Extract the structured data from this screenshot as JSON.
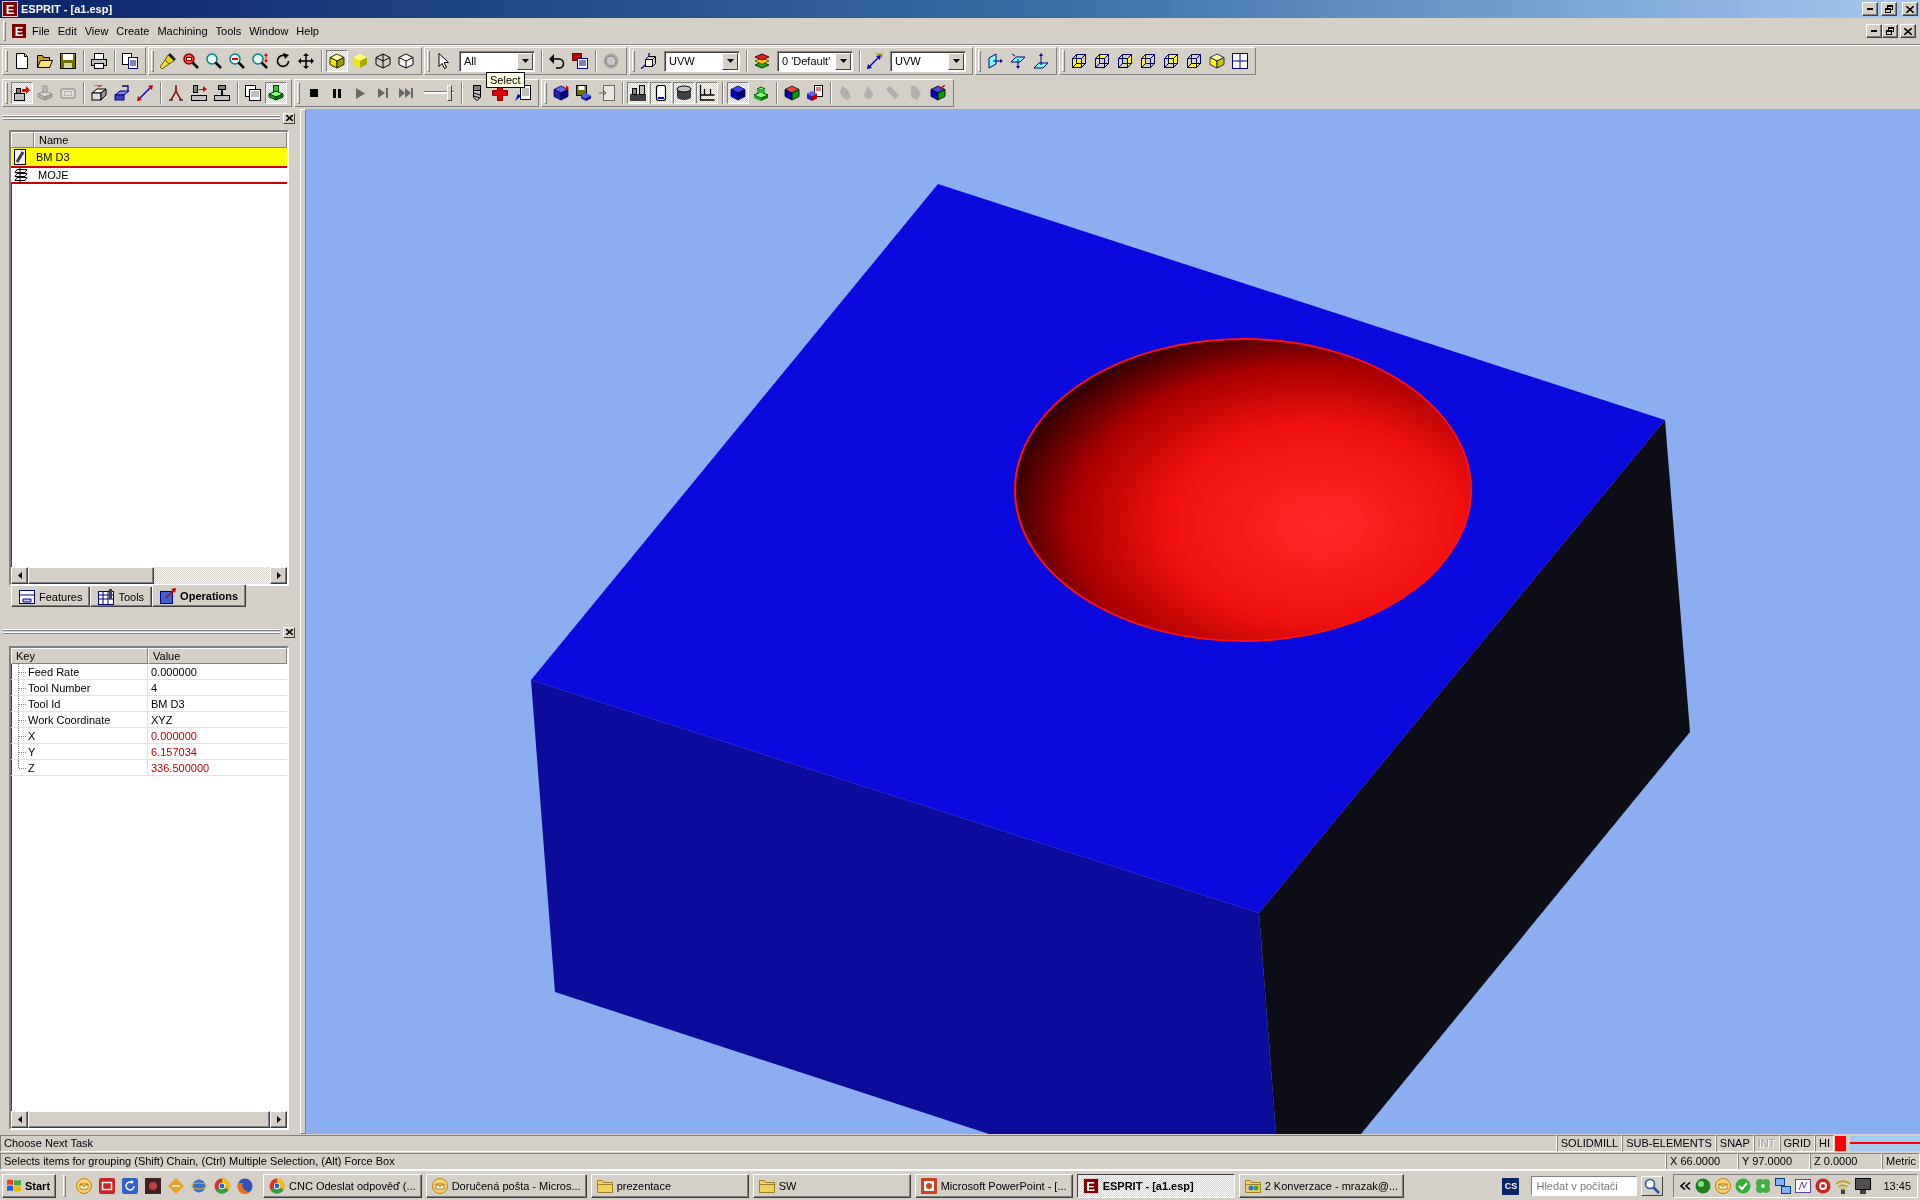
{
  "window": {
    "logo": "E",
    "title": "ESPRIT - [a1.esp]"
  },
  "menu_bar": {
    "logo": "E",
    "items": [
      "File",
      "Edit",
      "View",
      "Create",
      "Machining",
      "Tools",
      "Window",
      "Help"
    ]
  },
  "toolbar_rows": [
    {
      "toolbars": [
        {
          "groups": [
            [
              {
                "kind": "button",
                "pressed": false,
                "disabled": false
              },
              {
                "kind": "button",
                "pressed": false,
                "disabled": false
              },
              {
                "kind": "button",
                "pressed": false,
                "disabled": false
              }
            ],
            [
              {
                "kind": "button",
                "pressed": false,
                "disabled": false
              }
            ],
            [
              {
                "kind": "button",
                "pressed": false,
                "disabled": false
              }
            ]
          ]
        },
        {
          "groups": [
            [
              {
                "kind": "button",
                "pressed": false,
                "disabled": false
              },
              {
                "kind": "button",
                "pressed": false,
                "disabled": false
              },
              {
                "kind": "button",
                "pressed": false,
                "disabled": false
              },
              {
                "kind": "button",
                "pressed": false,
                "disabled": false
              },
              {
                "kind": "button",
                "pressed": false,
                "disabled": false
              },
              {
                "kind": "button",
                "pressed": false,
                "disabled": false
              },
              {
                "kind": "button",
                "pressed": false,
                "disabled": false
              }
            ],
            [
              {
                "kind": "button",
                "pressed": true,
                "disabled": false
              },
              {
                "kind": "button",
                "pressed": false,
                "disabled": false
              },
              {
                "kind": "button",
                "pressed": false,
                "disabled": false
              },
              {
                "kind": "button",
                "pressed": false,
                "disabled": false
              }
            ]
          ]
        },
        {
          "groups": [
            [
              {
                "kind": "button",
                "pressed": false,
                "disabled": false
              },
              {
                "kind": "dropdown",
                "value": "All"
              }
            ],
            [
              {
                "kind": "button",
                "pressed": false,
                "disabled": false
              },
              {
                "kind": "button",
                "pressed": false,
                "disabled": false
              }
            ],
            [
              {
                "kind": "button",
                "pressed": false,
                "disabled": false
              }
            ]
          ]
        },
        {
          "groups": [
            [
              {
                "kind": "button",
                "pressed": false,
                "disabled": false
              },
              {
                "kind": "dropdown",
                "value": "UVW"
              }
            ],
            [
              {
                "kind": "button",
                "pressed": false,
                "disabled": false
              },
              {
                "kind": "dropdown",
                "value": "0 'Default'"
              }
            ],
            [
              {
                "kind": "button",
                "pressed": false,
                "disabled": false
              },
              {
                "kind": "dropdown",
                "value": "UVW"
              }
            ]
          ]
        },
        {
          "groups": [
            [
              {
                "kind": "button",
                "pressed": false,
                "disabled": false
              },
              {
                "kind": "button",
                "pressed": false,
                "disabled": false
              },
              {
                "kind": "button",
                "pressed": false,
                "disabled": false
              }
            ]
          ]
        },
        {
          "groups": [
            [
              {
                "kind": "button",
                "pressed": false,
                "disabled": false
              },
              {
                "kind": "button",
                "pressed": false,
                "disabled": false
              },
              {
                "kind": "button",
                "pressed": false,
                "disabled": false
              },
              {
                "kind": "button",
                "pressed": false,
                "disabled": false
              },
              {
                "kind": "button",
                "pressed": false,
                "disabled": false
              },
              {
                "kind": "button",
                "pressed": false,
                "disabled": false
              },
              {
                "kind": "button",
                "pressed": false,
                "disabled": false
              },
              {
                "kind": "button",
                "pressed": false,
                "disabled": false
              }
            ]
          ]
        }
      ]
    },
    {
      "toolbars": [
        {
          "groups": [
            [
              {
                "kind": "button",
                "pressed": true,
                "disabled": false
              },
              {
                "kind": "button",
                "pressed": false,
                "disabled": true
              },
              {
                "kind": "button",
                "pressed": false,
                "disabled": true
              }
            ],
            [
              {
                "kind": "button",
                "pressed": false,
                "disabled": false
              },
              {
                "kind": "button",
                "pressed": false,
                "disabled": false
              },
              {
                "kind": "button",
                "pressed": false,
                "disabled": false
              }
            ],
            [
              {
                "kind": "button",
                "pressed": false,
                "disabled": false
              },
              {
                "kind": "button",
                "pressed": false,
                "disabled": false
              },
              {
                "kind": "button",
                "pressed": false,
                "disabled": false
              }
            ],
            [
              {
                "kind": "button",
                "pressed": false,
                "disabled": false
              },
              {
                "kind": "button",
                "pressed": true,
                "disabled": false
              }
            ]
          ]
        },
        {
          "groups": [
            [
              {
                "kind": "button",
                "pressed": false,
                "disabled": false
              },
              {
                "kind": "button",
                "pressed": false,
                "disabled": false
              },
              {
                "kind": "button",
                "pressed": false,
                "disabled": true
              },
              {
                "kind": "button",
                "pressed": false,
                "disabled": true
              },
              {
                "kind": "button",
                "pressed": false,
                "disabled": true
              },
              {
                "kind": "slider",
                "level": 0.9
              }
            ],
            [
              {
                "kind": "button",
                "pressed": false,
                "disabled": false
              },
              {
                "kind": "button",
                "pressed": false,
                "disabled": false
              },
              {
                "kind": "button",
                "pressed": false,
                "disabled": false
              }
            ]
          ]
        },
        {
          "groups": [
            [
              {
                "kind": "button",
                "pressed": false,
                "disabled": false
              },
              {
                "kind": "button",
                "pressed": false,
                "disabled": false
              },
              {
                "kind": "button",
                "pressed": false,
                "disabled": true
              }
            ],
            [
              {
                "kind": "button",
                "pressed": true,
                "disabled": false
              },
              {
                "kind": "button",
                "pressed": true,
                "disabled": false
              },
              {
                "kind": "button",
                "pressed": true,
                "disabled": false
              },
              {
                "kind": "button",
                "pressed": true,
                "disabled": false
              }
            ],
            [
              {
                "kind": "button",
                "pressed": true,
                "disabled": false
              },
              {
                "kind": "button",
                "pressed": false,
                "disabled": false
              }
            ],
            [
              {
                "kind": "button",
                "pressed": false,
                "disabled": false
              },
              {
                "kind": "button",
                "pressed": false,
                "disabled": false
              }
            ],
            [
              {
                "kind": "button",
                "pressed": false,
                "disabled": true
              },
              {
                "kind": "button",
                "pressed": false,
                "disabled": true
              },
              {
                "kind": "button",
                "pressed": false,
                "disabled": true
              },
              {
                "kind": "button",
                "pressed": false,
                "disabled": true
              },
              {
                "kind": "button",
                "pressed": false,
                "disabled": false
              }
            ]
          ]
        }
      ]
    }
  ],
  "tooltip": {
    "text": "Select"
  },
  "operations_panel": {
    "column": "Name",
    "rows": [
      {
        "kind": "tool",
        "name": "BM D3",
        "selected": true,
        "outlined": false
      },
      {
        "kind": "operation",
        "name": "MOJE",
        "selected": false,
        "outlined": true
      }
    ],
    "tabs": [
      {
        "label": "Features",
        "selected": false
      },
      {
        "label": "Tools",
        "selected": false
      },
      {
        "label": "Operations",
        "selected": true
      }
    ]
  },
  "properties_panel": {
    "columns": [
      "Key",
      "Value"
    ],
    "rows": [
      {
        "key": "Feed Rate",
        "value": "0.000000",
        "highlighted": false
      },
      {
        "key": "Tool Number",
        "value": "4",
        "highlighted": false
      },
      {
        "key": "Tool Id",
        "value": "BM D3",
        "highlighted": false
      },
      {
        "key": "Work Coordinate",
        "value": "XYZ",
        "highlighted": false
      },
      {
        "key": "X",
        "value": "0.000000",
        "highlighted": true
      },
      {
        "key": "Y",
        "value": "6.157034",
        "highlighted": true
      },
      {
        "key": "Z",
        "value": "336.500000",
        "highlighted": true
      }
    ]
  },
  "status_bar": {
    "prompt": "Choose Next Task",
    "hint": "Selects items for grouping (Shift) Chain, (Ctrl) Multiple Selection, (Alt) Force Box",
    "modes": [
      {
        "label": "SOLIDMILL",
        "enabled": true
      },
      {
        "label": "SUB-ELEMENTS",
        "enabled": true
      },
      {
        "label": "SNAP",
        "enabled": true
      },
      {
        "label": "INT",
        "enabled": false
      },
      {
        "label": "GRID",
        "enabled": true
      },
      {
        "label": "HI",
        "enabled": true
      }
    ],
    "coordinates": [
      "X 66.0000",
      "Y 97.0000",
      "Z 0.0000"
    ],
    "units": "Metric"
  },
  "taskbar": {
    "start": "Start",
    "tasks": [
      {
        "kind": "browser",
        "label": "CNC Odeslat odpověď (...",
        "selected": false
      },
      {
        "kind": "mail",
        "label": "Doručená pošta - Micros...",
        "selected": false
      },
      {
        "kind": "folder",
        "label": "prezentace",
        "selected": false
      },
      {
        "kind": "folder",
        "label": "SW",
        "selected": false
      },
      {
        "kind": "presentation",
        "label": "Microsoft PowerPoint - [...",
        "selected": false
      },
      {
        "kind": "app",
        "logo": "E",
        "label": "ESPRIT - [a1.esp]",
        "selected": true
      },
      {
        "kind": "messenger",
        "label": "2 Konverzace - mrazak@...",
        "selected": false
      }
    ],
    "language": "CS",
    "search": {
      "placeholder": "Hledat v počítači"
    },
    "clock": "13:45"
  }
}
